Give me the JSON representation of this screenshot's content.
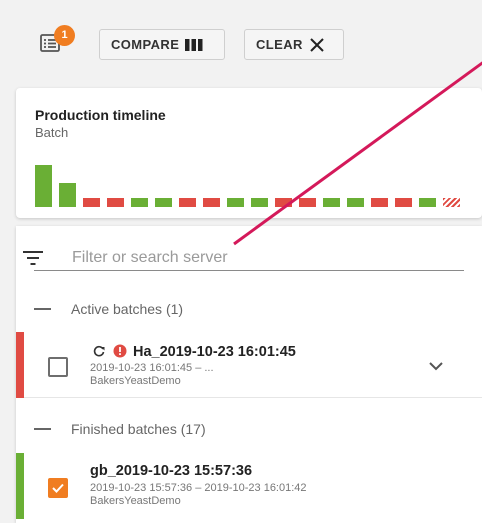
{
  "toolbar": {
    "badge_count": "1",
    "compare_label": "COMPARE",
    "clear_label": "CLEAR"
  },
  "timeline": {
    "title": "Production timeline",
    "subtitle": "Batch",
    "bars": [
      {
        "status": "success",
        "level": 0.64
      },
      {
        "status": "success",
        "level": 0.36
      },
      {
        "status": "failed",
        "level": 0.14
      },
      {
        "status": "failed",
        "level": 0.14
      },
      {
        "status": "success",
        "level": 0.14
      },
      {
        "status": "success",
        "level": 0.14
      },
      {
        "status": "failed",
        "level": 0.14
      },
      {
        "status": "failed",
        "level": 0.14
      },
      {
        "status": "success",
        "level": 0.14
      },
      {
        "status": "success",
        "level": 0.14
      },
      {
        "status": "failed",
        "level": 0.14
      },
      {
        "status": "failed",
        "level": 0.14
      },
      {
        "status": "success",
        "level": 0.14
      },
      {
        "status": "success",
        "level": 0.14
      },
      {
        "status": "failed",
        "level": 0.14
      },
      {
        "status": "failed",
        "level": 0.14
      },
      {
        "status": "success",
        "level": 0.14
      },
      {
        "status": "active",
        "level": 0.14
      }
    ],
    "colors": {
      "success": "#6aaf35",
      "failed": "#e04b43",
      "active": "#e04b43"
    }
  },
  "filter": {
    "placeholder": "Filter or search server"
  },
  "sections": {
    "active_label": "Active batches (1)",
    "finished_label": "Finished batches (17)"
  },
  "active_batch": {
    "name": "Ha_2019-10-23 16:01:45",
    "time": "2019-10-23 16:01:45 – ...",
    "server": "BakersYeastDemo",
    "stripe_color": "#e04b43",
    "checked": false
  },
  "finished_batch": {
    "name": "gb_2019-10-23 15:57:36",
    "time": "2019-10-23 15:57:36 – 2019-10-23 16:01:42",
    "server": "BakersYeastDemo",
    "stripe_color": "#6aaf35",
    "checked": true
  },
  "colors": {
    "accent": "#f07d21",
    "error": "#e04b43",
    "annotation": "#d4195a"
  },
  "icons": [
    "list-icon",
    "compare-columns-icon",
    "close-icon",
    "filter-icon",
    "sync-icon",
    "error-icon",
    "chevron-down-icon",
    "checkmark-icon"
  ]
}
